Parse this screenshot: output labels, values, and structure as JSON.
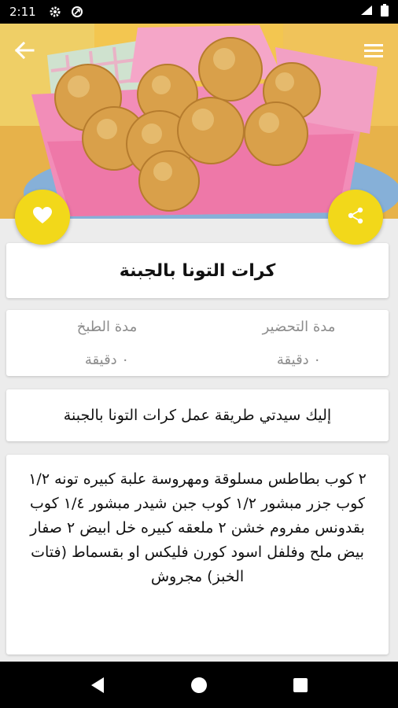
{
  "status_bar": {
    "time": "2:11"
  },
  "recipe": {
    "title": "كرات التونا بالجبنة",
    "prep_time_label": "مدة التحضير",
    "prep_time_value": "٠ دقيقة",
    "cook_time_label": "مدة الطبخ",
    "cook_time_value": "٠ دقيقة",
    "intro": "إليك سيدتي طريقة عمل كرات التونا بالجبنة",
    "ingredients": "٢ كوب بطاطس مسلوقة ومهروسة علبة كبيره تونه ١/٢ كوب جزر مبشور ١/٢ كوب جبن شيدر مبشور ١/٤ كوب بقدونس مفروم خشن ٢ ملعقه كبيره خل ابيض ٢ صفار بيض ملح وفلفل اسود كورن فليكس او بقسماط (فتات الخبز) مجروش"
  },
  "colors": {
    "fab": "#f2d81a",
    "background": "#ececec"
  },
  "icons": {
    "back": "arrow-left-icon",
    "menu": "hamburger-menu-icon",
    "favorite": "heart-icon",
    "share": "share-icon"
  }
}
